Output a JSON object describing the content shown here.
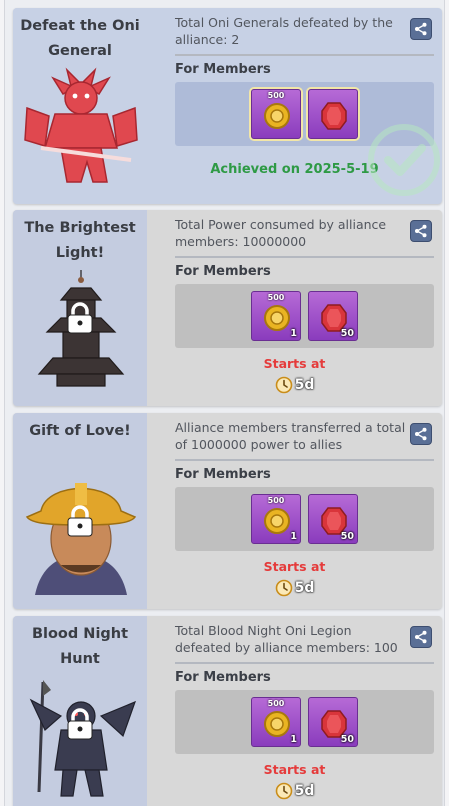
{
  "colors": {
    "achieved_bg": "#c7d1e5",
    "pending_bg": "#d8d8d8",
    "achieved_text": "#2e9a45",
    "starts_text": "#e53b3b",
    "item_purple": "#9d4fc9"
  },
  "cards": [
    {
      "title": "Defeat the Oni General",
      "description": "Total Oni Generals defeated by the alliance: 2",
      "members_label": "For Members",
      "rewards": [
        {
          "icon": "gold-coin-chest-icon",
          "top_label": "500",
          "qty": ""
        },
        {
          "icon": "red-gem-icon",
          "top_label": "",
          "qty": ""
        }
      ],
      "status": "achieved",
      "achieved_text": "Achieved on 2025-5-19",
      "locked": false
    },
    {
      "title": "The Brightest Light!",
      "description": "Total Power consumed by alliance members: 10000000",
      "members_label": "For Members",
      "rewards": [
        {
          "icon": "gold-coin-chest-icon",
          "top_label": "500",
          "qty": "1"
        },
        {
          "icon": "red-gem-icon",
          "top_label": "",
          "qty": "50"
        }
      ],
      "status": "pending",
      "starts_label": "Starts at",
      "timer": "5d",
      "locked": true
    },
    {
      "title": "Gift of Love!",
      "description": "Alliance members transferred a total of 1000000 power to allies",
      "members_label": "For Members",
      "rewards": [
        {
          "icon": "gold-coin-chest-icon",
          "top_label": "500",
          "qty": "1"
        },
        {
          "icon": "red-gem-icon",
          "top_label": "",
          "qty": "50"
        }
      ],
      "status": "pending",
      "starts_label": "Starts at",
      "timer": "5d",
      "locked": true
    },
    {
      "title": "Blood Night Hunt",
      "description": "Total Blood Night Oni Legion defeated by alliance members: 100",
      "members_label": "For Members",
      "rewards": [
        {
          "icon": "gold-coin-chest-icon",
          "top_label": "500",
          "qty": "1"
        },
        {
          "icon": "red-gem-icon",
          "top_label": "",
          "qty": "50"
        }
      ],
      "status": "pending",
      "starts_label": "Starts at",
      "timer": "5d",
      "locked": true
    }
  ]
}
